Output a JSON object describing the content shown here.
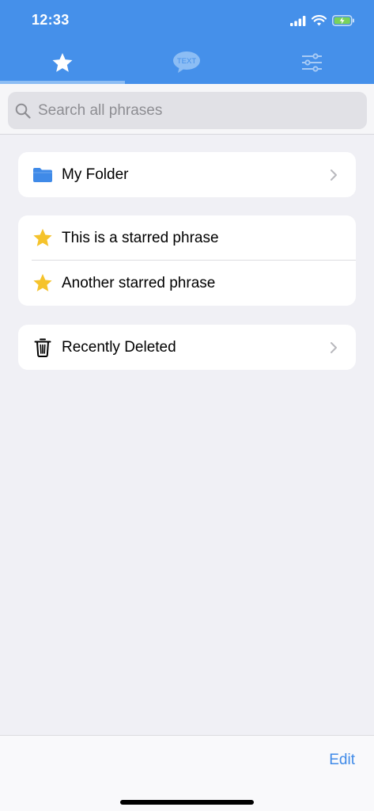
{
  "status_bar": {
    "time": "12:33"
  },
  "tabs": [
    {
      "icon": "star-icon",
      "selected": true
    },
    {
      "icon": "text-bubble-icon",
      "text": "TEXT",
      "selected": false
    },
    {
      "icon": "sliders-icon",
      "selected": false
    }
  ],
  "search": {
    "placeholder": "Search all phrases"
  },
  "folders": [
    {
      "icon": "folder-icon",
      "label": "My Folder"
    }
  ],
  "starred": [
    {
      "icon": "star-icon",
      "label": "This is a starred phrase"
    },
    {
      "icon": "star-icon",
      "label": "Another starred phrase"
    }
  ],
  "trash": {
    "icon": "trash-icon",
    "label": "Recently Deleted"
  },
  "toolbar": {
    "edit_label": "Edit"
  },
  "colors": {
    "header": "#4590ea",
    "accent": "#3f8ae8",
    "star": "#f5c32c",
    "folder": "#3f8ae8"
  }
}
